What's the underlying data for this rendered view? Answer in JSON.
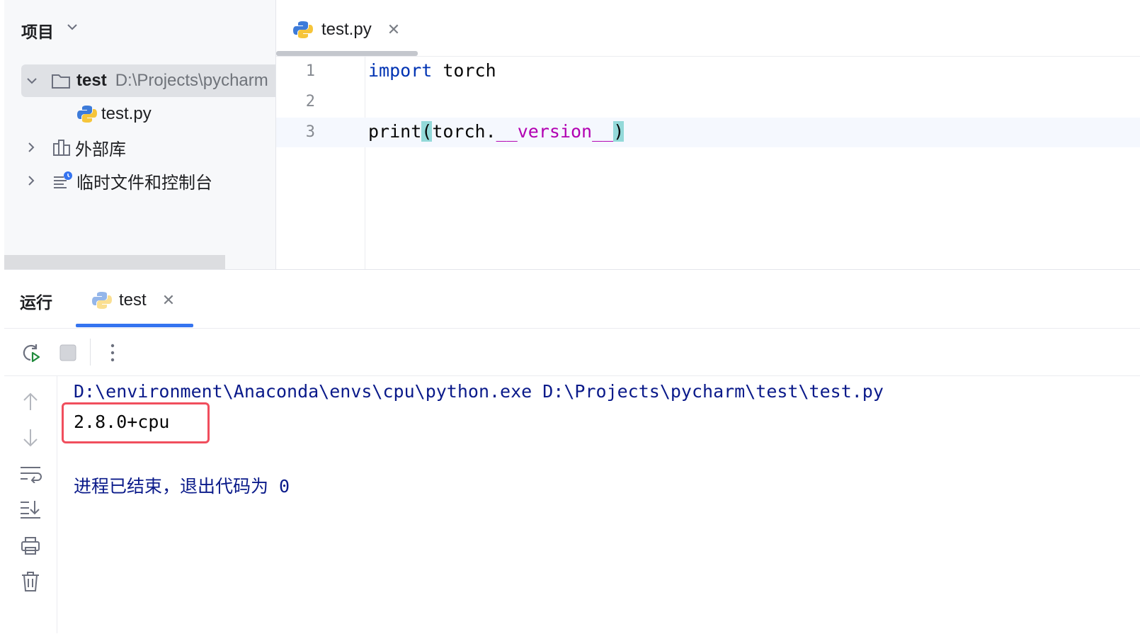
{
  "project": {
    "title": "项目",
    "root_name": "test",
    "root_path": "D:\\Projects\\pycharm",
    "file_name": "test.py",
    "external_libs": "外部库",
    "scratches": "临时文件和控制台"
  },
  "editor": {
    "tab_label": "test.py",
    "line_numbers": [
      "1",
      "2",
      "3"
    ],
    "code": {
      "line1_keyword": "import",
      "line1_rest": " torch",
      "line3_func": "print",
      "line3_open": "(",
      "line3_obj": "torch.",
      "line3_attr": "__version__",
      "line3_close": ")"
    }
  },
  "run": {
    "title": "运行",
    "tab_label": "test",
    "console": {
      "command": "D:\\environment\\Anaconda\\envs\\cpu\\python.exe D:\\Projects\\pycharm\\test\\test.py",
      "output": "2.8.0+cpu",
      "exit_message": "进程已结束，退出代码为 0"
    }
  },
  "colors": {
    "accent": "#3574f0",
    "highlight_box": "#f04e5d",
    "keyword": "#0033b3",
    "dunder": "#b200b2",
    "console_text": "#0a1a8a"
  },
  "icons": [
    "chevron-down-icon",
    "folder-icon",
    "python-icon",
    "library-icon",
    "scratch-icon",
    "close-icon",
    "rerun-icon",
    "stop-icon",
    "more-icon",
    "up-arrow-icon",
    "down-arrow-icon",
    "soft-wrap-icon",
    "scroll-end-icon",
    "print-icon",
    "trash-icon"
  ]
}
